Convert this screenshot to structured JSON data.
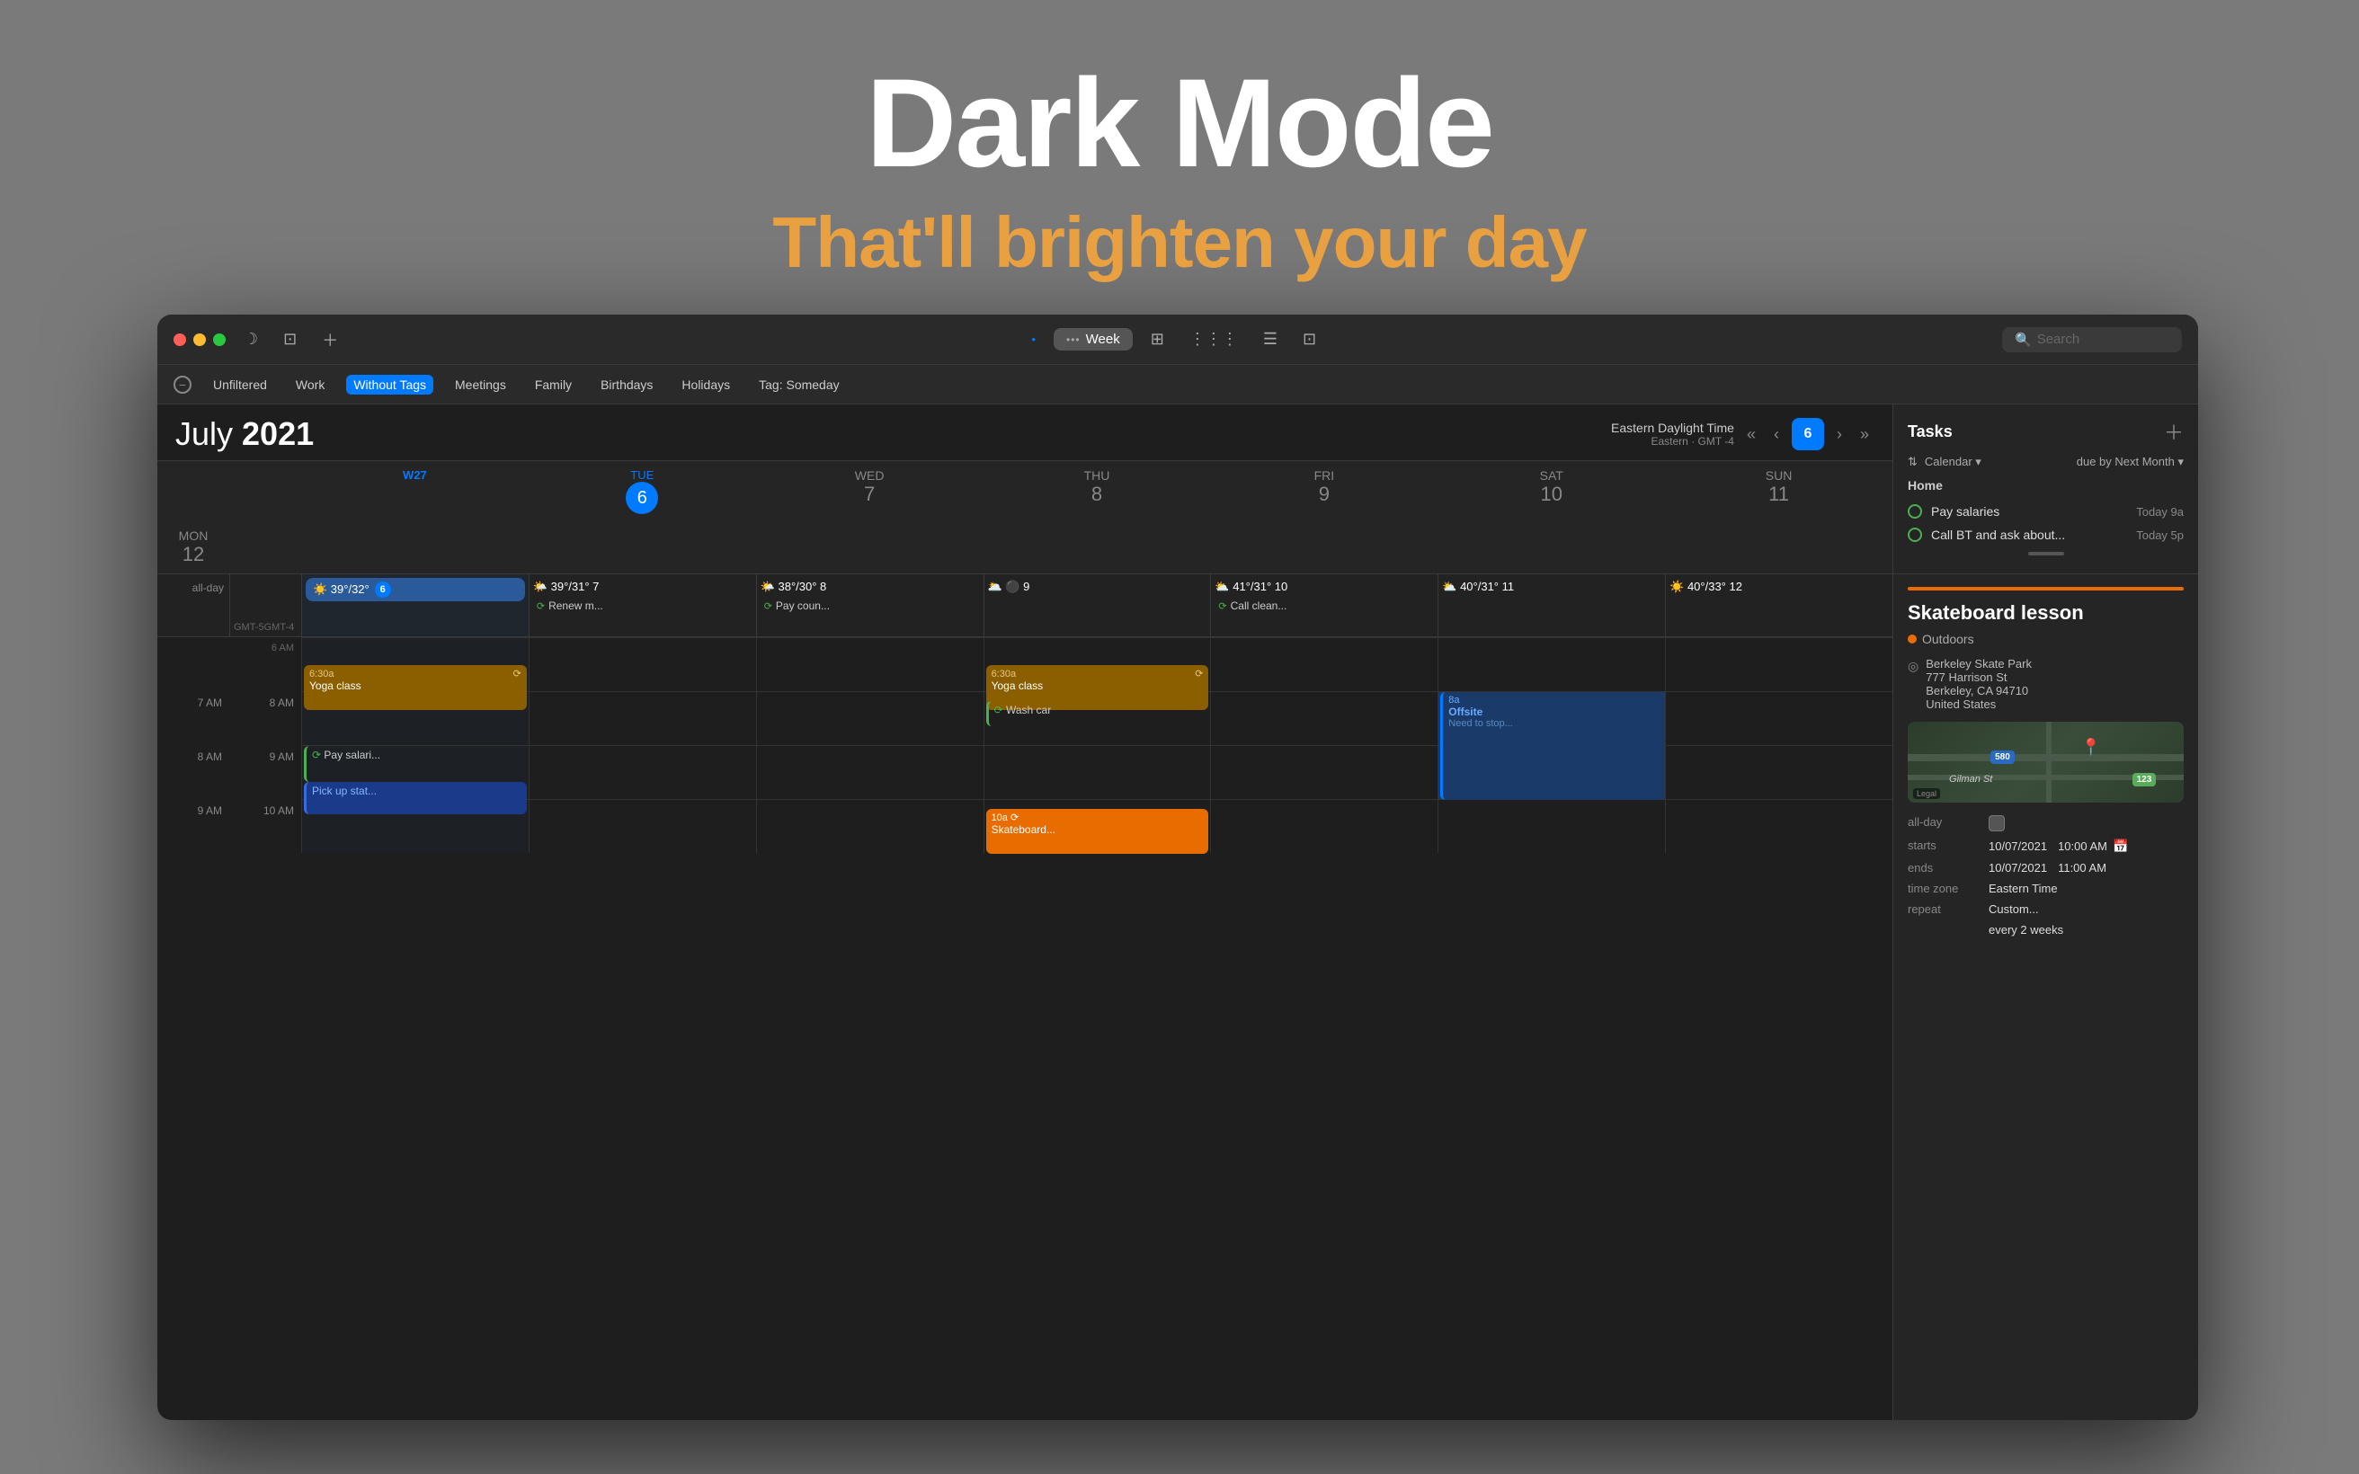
{
  "hero": {
    "title": "Dark Mode",
    "subtitle": "That'll brighten your day"
  },
  "window": {
    "titlebar": {
      "week_label": "Week",
      "dots": "•••",
      "search_placeholder": "Search"
    },
    "filterbar": {
      "filters": [
        "Unfiltered",
        "Work",
        "Without Tags",
        "Meetings",
        "Family",
        "Birthdays",
        "Holidays",
        "Tag: Someday"
      ],
      "active": "Without Tags"
    },
    "calendar": {
      "month": "July",
      "year": "2021",
      "week_num": "W27",
      "timezone_main": "Eastern Daylight Time",
      "timezone_sub": "Eastern · GMT -4",
      "today_num": "6",
      "days": [
        {
          "label": "TUE",
          "num": "6",
          "is_today": true
        },
        {
          "label": "WED",
          "num": "7"
        },
        {
          "label": "THU",
          "num": "8"
        },
        {
          "label": "FRI",
          "num": "9"
        },
        {
          "label": "SAT",
          "num": "10"
        },
        {
          "label": "SUN",
          "num": "11"
        },
        {
          "label": "MON",
          "num": "12"
        }
      ],
      "allday_weather": [
        {
          "temp": "39°/32°",
          "icon": "☀️",
          "day": 6
        },
        {
          "temp": "39°/31°",
          "icon": "🌤️",
          "day": 7
        },
        {
          "temp": "38°/30°",
          "icon": "🌤️",
          "day": 8
        },
        {
          "temp": "",
          "icon": "🌥️",
          "day": 9
        },
        {
          "temp": "41°/31°",
          "icon": "⛅",
          "day": 10
        },
        {
          "temp": "40°/31°",
          "icon": "⛅",
          "day": 11
        },
        {
          "temp": "40°/33°",
          "icon": "☀️",
          "day": 12
        }
      ],
      "allday_events": [
        {
          "day": 7,
          "text": "Renew m...",
          "type": "repeat"
        },
        {
          "day": 8,
          "text": "Pay coun...",
          "type": "repeat"
        },
        {
          "day": 10,
          "text": "Call clean...",
          "type": "repeat"
        }
      ]
    },
    "time_slots": [
      "6 AM",
      "7 AM",
      "8 AM",
      "9 AM",
      "10 AM"
    ],
    "gmt_labels": [
      "GMT-5",
      "GMT-4"
    ],
    "events": [
      {
        "id": "yoga1",
        "day": 1,
        "time": "6:30a",
        "title": "Yoga class",
        "type": "yoga",
        "has_repeat": true
      },
      {
        "id": "yoga2",
        "day": 4,
        "time": "6:30a",
        "title": "Yoga class",
        "type": "yoga",
        "has_repeat": true
      },
      {
        "id": "wash",
        "day": 4,
        "time": "8a",
        "title": "⟳ Wash car",
        "type": "wash"
      },
      {
        "id": "offsite",
        "day": 6,
        "time": "8a",
        "title": "Offsite",
        "subtitle": "Need to stop...",
        "type": "offsite"
      },
      {
        "id": "pay",
        "day": 1,
        "time": "9a",
        "title": "⟳ Pay salari...",
        "type": "green"
      },
      {
        "id": "pickup",
        "day": 1,
        "time": "9:30a",
        "title": "Pick up stat...",
        "type": "blue-outline"
      },
      {
        "id": "skateboard",
        "day": 4,
        "time": "10a",
        "title": "Skateboard...",
        "type": "skateboard"
      }
    ],
    "tasks": {
      "title": "Tasks",
      "group": "Home",
      "calendar_label": "Calendar",
      "due_label": "due by Next Month",
      "items": [
        {
          "name": "Pay salaries",
          "time": "Today 9a"
        },
        {
          "name": "Call BT and ask about...",
          "time": "Today 5p"
        }
      ]
    },
    "event_detail": {
      "title": "Skateboard lesson",
      "calendar": "Outdoors",
      "location_lines": [
        "Berkeley Skate Park",
        "777 Harrison St",
        "Berkeley, CA  94710",
        "United States"
      ],
      "allday": false,
      "starts_date": "10/07/2021",
      "starts_time": "10:00 AM",
      "ends_date": "10/07/2021",
      "ends_time": "11:00 AM",
      "timezone": "Eastern Time",
      "repeat": "Custom...",
      "repeat_freq": "every 2 weeks"
    }
  }
}
